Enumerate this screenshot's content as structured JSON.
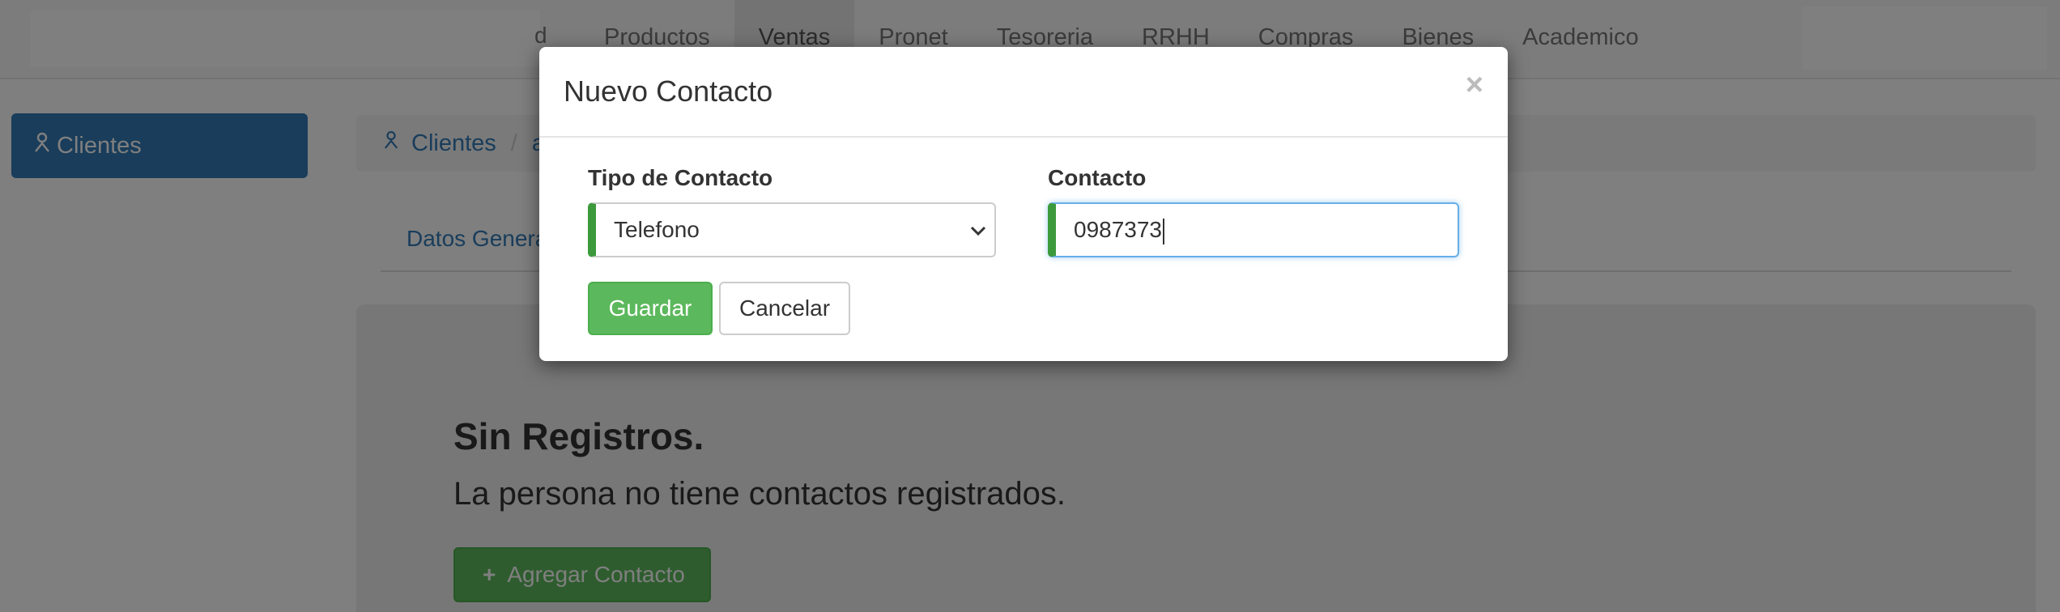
{
  "navbar": {
    "hidden_fragment": "d",
    "items": [
      {
        "label": "Productos"
      },
      {
        "label": "Ventas",
        "active": true
      },
      {
        "label": "Pronet"
      },
      {
        "label": "Tesoreria"
      },
      {
        "label": "RRHH"
      },
      {
        "label": "Compras"
      },
      {
        "label": "Bienes"
      },
      {
        "label": "Academico"
      }
    ]
  },
  "sidebar": {
    "header_label": "Clientes",
    "header_icon": "user-icon"
  },
  "breadcrumb": {
    "first_label": "Clientes",
    "separator": "/",
    "hidden_fragment": "a"
  },
  "tabs": {
    "first_label": "Datos Genera"
  },
  "empty_state": {
    "title": "Sin Registros.",
    "text": "La persona no tiene contactos registrados.",
    "add_button_label": "Agregar Contacto",
    "add_button_icon": "plus-icon"
  },
  "modal": {
    "title": "Nuevo Contacto",
    "close_symbol": "×",
    "type_label": "Tipo de Contacto",
    "type_value": "Telefono",
    "contact_label": "Contacto",
    "contact_value": "0987373",
    "save_label": "Guardar",
    "cancel_label": "Cancelar"
  },
  "colors": {
    "primary": "#337ab7",
    "success": "#5cb85c",
    "field_accent": "#3c9a3c",
    "focus": "#66afe9"
  }
}
